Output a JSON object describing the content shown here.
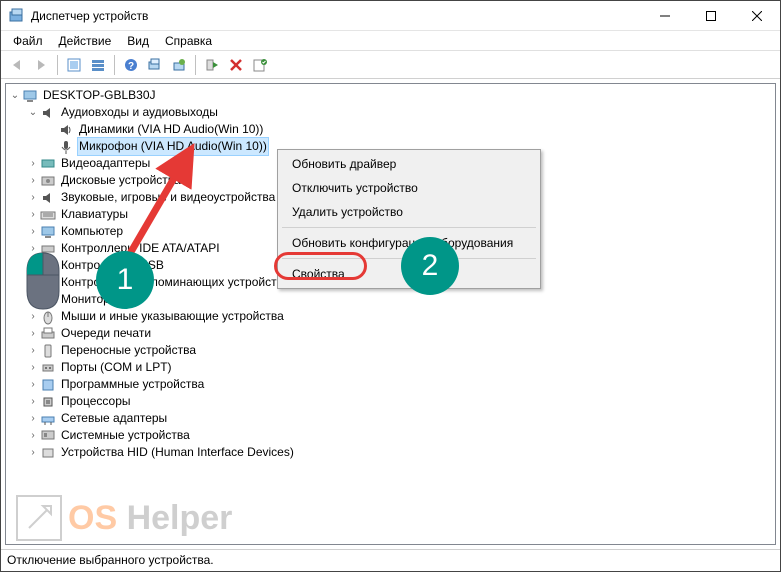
{
  "window": {
    "title": "Диспетчер устройств"
  },
  "menubar": {
    "file": "Файл",
    "action": "Действие",
    "view": "Вид",
    "help": "Справка"
  },
  "tree": {
    "root": "DESKTOP-GBLB30J",
    "cat_audio": "Аудиовходы и аудиовыходы",
    "dev_speakers": "Динамики (VIA HD Audio(Win 10))",
    "dev_mic": "Микрофон (VIA HD Audio(Win 10))",
    "cat_display": "Видеоадаптеры",
    "cat_disk": "Дисковые устройства",
    "cat_sound": "Звуковые, игровые и видеоустройства",
    "cat_keyboard": "Клавиатуры",
    "cat_computer": "Компьютер",
    "cat_ide": "Контроллеры IDE ATA/ATAPI",
    "cat_usb": "Контроллеры USB",
    "cat_storage": "Контроллеры запоминающих устройств",
    "cat_monitor": "Мониторы",
    "cat_mouse": "Мыши и иные указывающие устройства",
    "cat_print": "Очереди печати",
    "cat_portable": "Переносные устройства",
    "cat_ports": "Порты (COM и LPT)",
    "cat_software": "Программные устройства",
    "cat_cpu": "Процессоры",
    "cat_net": "Сетевые адаптеры",
    "cat_system": "Системные устройства",
    "cat_hid": "Устройства HID (Human Interface Devices)"
  },
  "context_menu": {
    "update_driver": "Обновить драйвер",
    "disable": "Отключить устройство",
    "uninstall": "Удалить устройство",
    "scan": "Обновить конфигурацию оборудования",
    "properties": "Свойства"
  },
  "statusbar": {
    "text": "Отключение выбранного устройства."
  },
  "annotations": {
    "n1": "1",
    "n2": "2"
  },
  "watermark": {
    "os": "OS",
    "helper": " Helper"
  }
}
